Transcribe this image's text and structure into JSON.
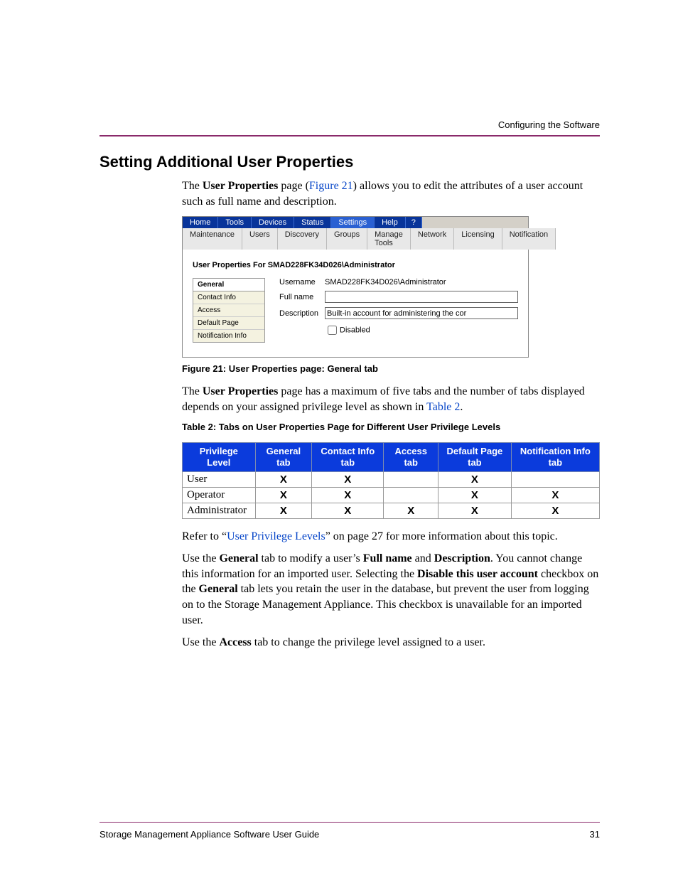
{
  "header": {
    "running": "Configuring the Software"
  },
  "section": {
    "title": "Setting Additional User Properties"
  },
  "para1": {
    "pre": "The ",
    "b1": "User Properties",
    "mid1": " page (",
    "link1": "Figure 21",
    "mid2": ") allows you to edit the attributes of a user account such as full name and description."
  },
  "screenshot": {
    "nav_top": [
      "Home",
      "Tools",
      "Devices",
      "Status",
      "Settings",
      "Help",
      "?"
    ],
    "nav_sub": [
      "Maintenance",
      "Users",
      "Discovery",
      "Groups",
      "Manage Tools",
      "Network",
      "Licensing",
      "Notification"
    ],
    "title": "User Properties For SMAD228FK34D026\\Administrator",
    "side_tabs": [
      "General",
      "Contact Info",
      "Access",
      "Default Page",
      "Notification Info"
    ],
    "form": {
      "username_label": "Username",
      "username_value": "SMAD228FK34D026\\Administrator",
      "fullname_label": "Full name",
      "fullname_value": "",
      "description_label": "Description",
      "description_value": "Built-in account for administering the cor",
      "disabled_label": "Disabled"
    }
  },
  "fig_caption": "Figure 21:  User Properties page: General tab",
  "para2": {
    "pre": "The ",
    "b1": "User Properties",
    "mid": " page has a maximum of five tabs and the number of tabs displayed depends on your assigned privilege level as shown in ",
    "link": "Table 2",
    "post": "."
  },
  "tbl_caption": "Table 2:  Tabs on User Properties Page for Different User Privilege Levels",
  "table": {
    "headers": [
      "Privilege Level",
      "General tab",
      "Contact Info tab",
      "Access tab",
      "Default Page tab",
      "Notification Info tab"
    ],
    "rows": [
      {
        "level": "User",
        "cells": [
          "X",
          "X",
          "",
          "X",
          ""
        ]
      },
      {
        "level": "Operator",
        "cells": [
          "X",
          "X",
          "",
          "X",
          "X"
        ]
      },
      {
        "level": "Administrator",
        "cells": [
          "X",
          "X",
          "X",
          "X",
          "X"
        ]
      }
    ]
  },
  "para3": {
    "pre": "Refer to “",
    "link": "User Privilege Levels",
    "post": "” on page 27 for more information about this topic."
  },
  "para4": {
    "t1": "Use the ",
    "b1": "General",
    "t2": " tab to modify a user’s ",
    "b2": "Full name",
    "t3": " and ",
    "b3": "Description",
    "t4": ". You cannot change this information for an imported user. Selecting the ",
    "b4": "Disable this user account",
    "t5": " checkbox on the ",
    "b5": "General",
    "t6": " tab lets you retain the user in the database, but prevent the user from logging on to the Storage Management Appliance. This checkbox is unavailable for an imported user."
  },
  "para5": {
    "t1": "Use the ",
    "b1": "Access",
    "t2": " tab to change the privilege level assigned to a user."
  },
  "footer": {
    "left": "Storage Management Appliance Software User Guide",
    "right": "31"
  }
}
